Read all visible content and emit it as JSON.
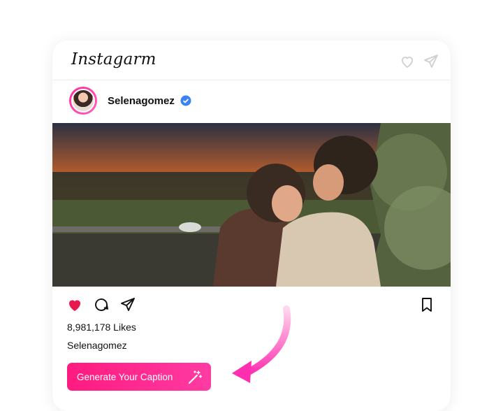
{
  "app": {
    "brand": "Instagarm"
  },
  "post": {
    "username": "Selenagomez",
    "verified": true,
    "likes_text": "8,981,178 Likes",
    "caption_username": "Selenagomez"
  },
  "cta": {
    "label": "Generate Your Caption"
  },
  "colors": {
    "accent": "#ff1b7f",
    "like": "#e8194f",
    "verified": "#3b82f6"
  },
  "icons": {
    "top": [
      "heart-outline-icon",
      "send-icon"
    ],
    "actions": [
      "heart-filled-icon",
      "comment-icon",
      "send-icon"
    ],
    "save": "bookmark-icon",
    "cta": "magic-wand-icon"
  }
}
